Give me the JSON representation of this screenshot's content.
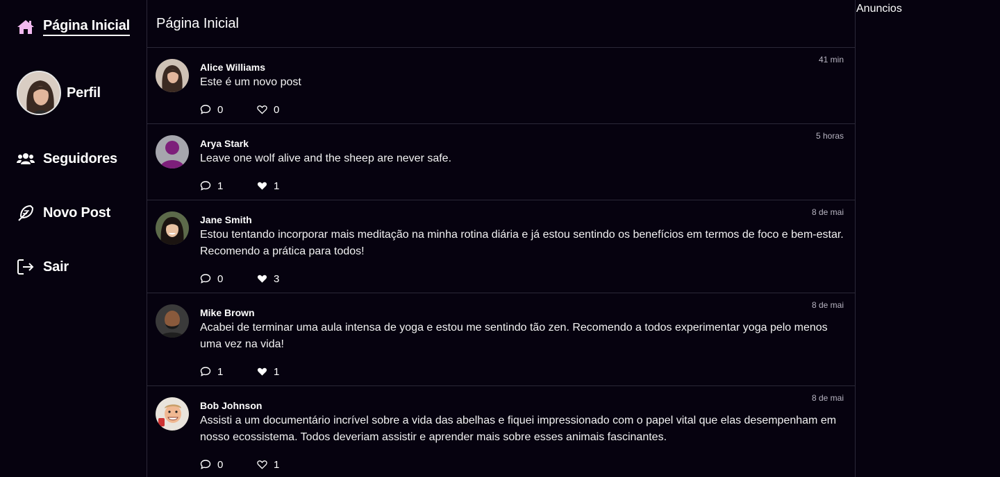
{
  "sidebar": {
    "home_label": "Página Inicial",
    "profile_label": "Perfil",
    "followers_label": "Seguidores",
    "new_post_label": "Novo Post",
    "exit_label": "Sair"
  },
  "feed": {
    "title": "Página Inicial",
    "posts": [
      {
        "author": "Alice Williams",
        "time": "41 min",
        "content": "Este é um novo post",
        "comments": "0",
        "likes": "0",
        "liked": false
      },
      {
        "author": "Arya Stark",
        "time": "5 horas",
        "content": "Leave one wolf alive and the sheep are never safe.",
        "comments": "1",
        "likes": "1",
        "liked": true
      },
      {
        "author": "Jane Smith",
        "time": "8 de mai",
        "content": "Estou tentando incorporar mais meditação na minha rotina diária e já estou sentindo os benefícios em termos de foco e bem-estar. Recomendo a prática para todos!",
        "comments": "0",
        "likes": "3",
        "liked": true
      },
      {
        "author": "Mike Brown",
        "time": "8 de mai",
        "content": "Acabei de terminar uma aula intensa de yoga e estou me sentindo tão zen. Recomendo a todos experimentar yoga pelo menos uma vez na vida!",
        "comments": "1",
        "likes": "1",
        "liked": true
      },
      {
        "author": "Bob Johnson",
        "time": "8 de mai",
        "content": "Assisti a um documentário incrível sobre a vida das abelhas e fiquei impressionado com o papel vital que elas desempenham em nosso ecossistema. Todos deveriam assistir e aprender mais sobre esses animais fascinantes.",
        "comments": "0",
        "likes": "1",
        "liked": false
      }
    ]
  },
  "ads": {
    "title": "Anuncios"
  },
  "colors": {
    "background": "#06020f",
    "accent_home_icon": "#f1b9ef",
    "border": "#2b2838"
  }
}
